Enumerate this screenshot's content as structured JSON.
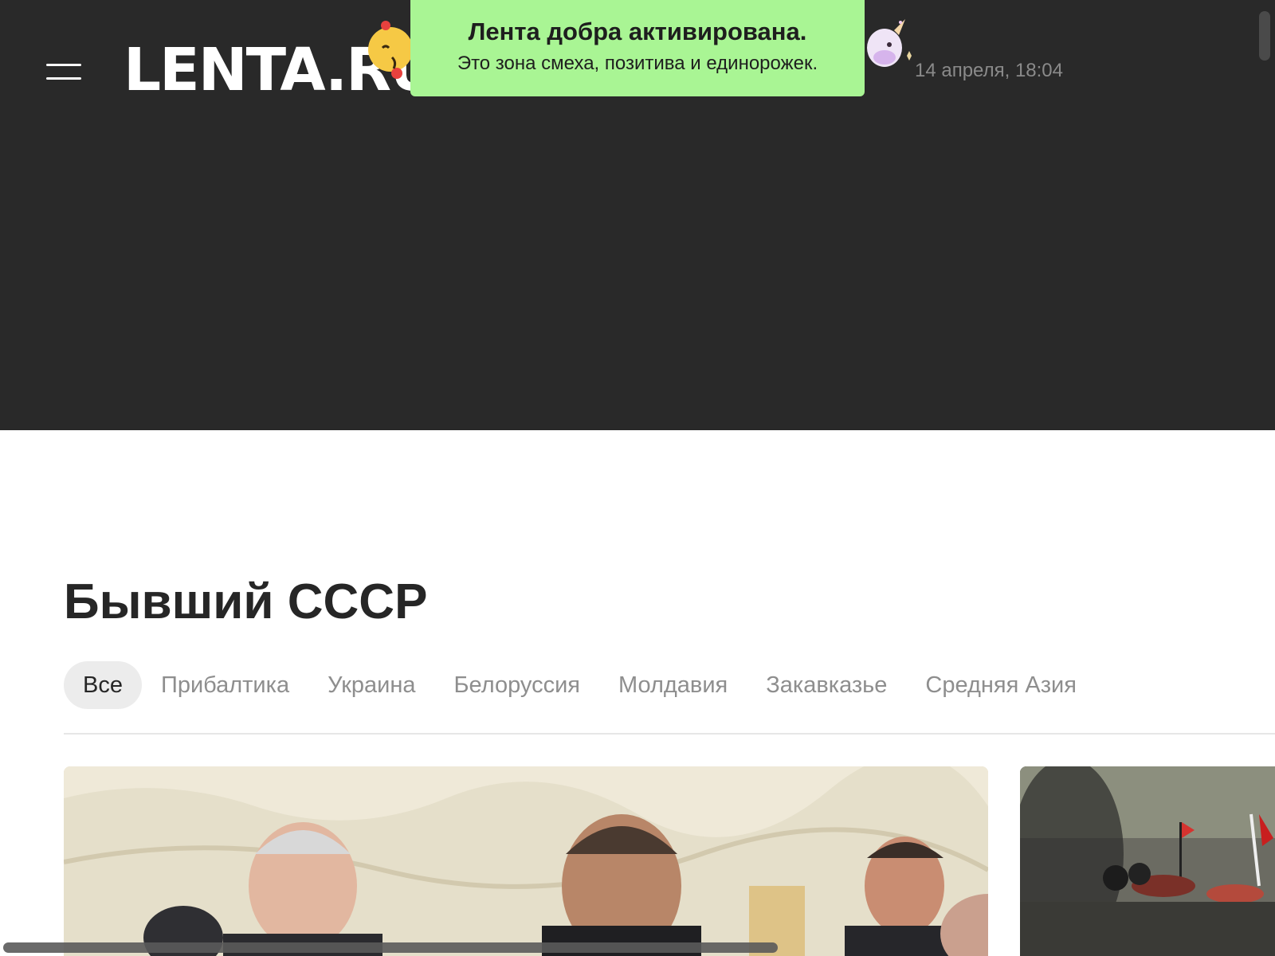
{
  "header": {
    "logo_text": "LENTA.RU",
    "datetime": "14 апреля, 18:04",
    "background": "#292929"
  },
  "toast": {
    "title": "Лента добра активирована.",
    "subtitle": "Это зона смеха, позитива и единорожек.",
    "background": "#a9f594"
  },
  "page": {
    "title": "Бывший СССР"
  },
  "tabs": [
    {
      "label": "Все",
      "active": true
    },
    {
      "label": "Прибалтика",
      "active": false
    },
    {
      "label": "Украина",
      "active": false
    },
    {
      "label": "Белоруссия",
      "active": false
    },
    {
      "label": "Молдавия",
      "active": false
    },
    {
      "label": "Закавказье",
      "active": false
    },
    {
      "label": "Средняя Азия",
      "active": false
    }
  ],
  "icons": {
    "menu": "hamburger-menu-icon",
    "mascot_left": "smiling-sun-mascot",
    "mascot_right": "unicorn-mascot"
  }
}
